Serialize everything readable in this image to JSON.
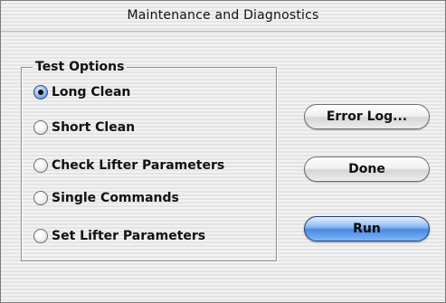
{
  "window": {
    "title": "Maintenance and Diagnostics"
  },
  "test_options": {
    "title": "Test Options",
    "selected_index": 0,
    "options": [
      {
        "label": "Long Clean",
        "checked": true
      },
      {
        "label": "Short Clean",
        "checked": false
      },
      {
        "label": "Check Lifter Parameters",
        "checked": false
      },
      {
        "label": "Single Commands",
        "checked": false
      },
      {
        "label": "Set Lifter Parameters",
        "checked": false
      }
    ]
  },
  "buttons": {
    "error_log": "Error Log...",
    "done": "Done",
    "run": "Run"
  },
  "colors": {
    "default_button": "#4a8ae0",
    "window_background": "#ececec"
  }
}
